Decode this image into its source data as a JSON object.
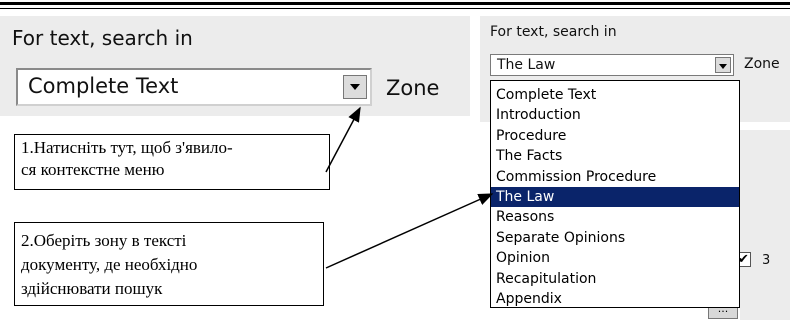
{
  "left_panel": {
    "label": "For text, search in",
    "select_value": "Complete Text",
    "zone_label": "Zone"
  },
  "callouts": {
    "step1_line1": "1.Натисніть тут, щоб з'явило-",
    "step1_line2": "ся контекстне меню",
    "step2_line1": "2.Оберіть зону  в  тексті",
    "step2_line2": "документу, де необхідно",
    "step2_line3": "здійснювати пошук"
  },
  "right_panel": {
    "label": "For text, search in",
    "select_value": "The Law",
    "zone_label": "Zone",
    "checkbox_mark": "✔",
    "checkbox_number": "3",
    "partial_button": "..."
  },
  "dropdown": {
    "options": [
      "Complete Text",
      "Introduction",
      "Procedure",
      "The Facts",
      "Commission Procedure",
      "The Law",
      "Reasons",
      "Separate Opinions",
      "Opinion",
      "Recapitulation",
      "Appendix"
    ],
    "selected": "The Law"
  },
  "colors": {
    "highlight": "#0a246a",
    "panel": "#ececec"
  }
}
